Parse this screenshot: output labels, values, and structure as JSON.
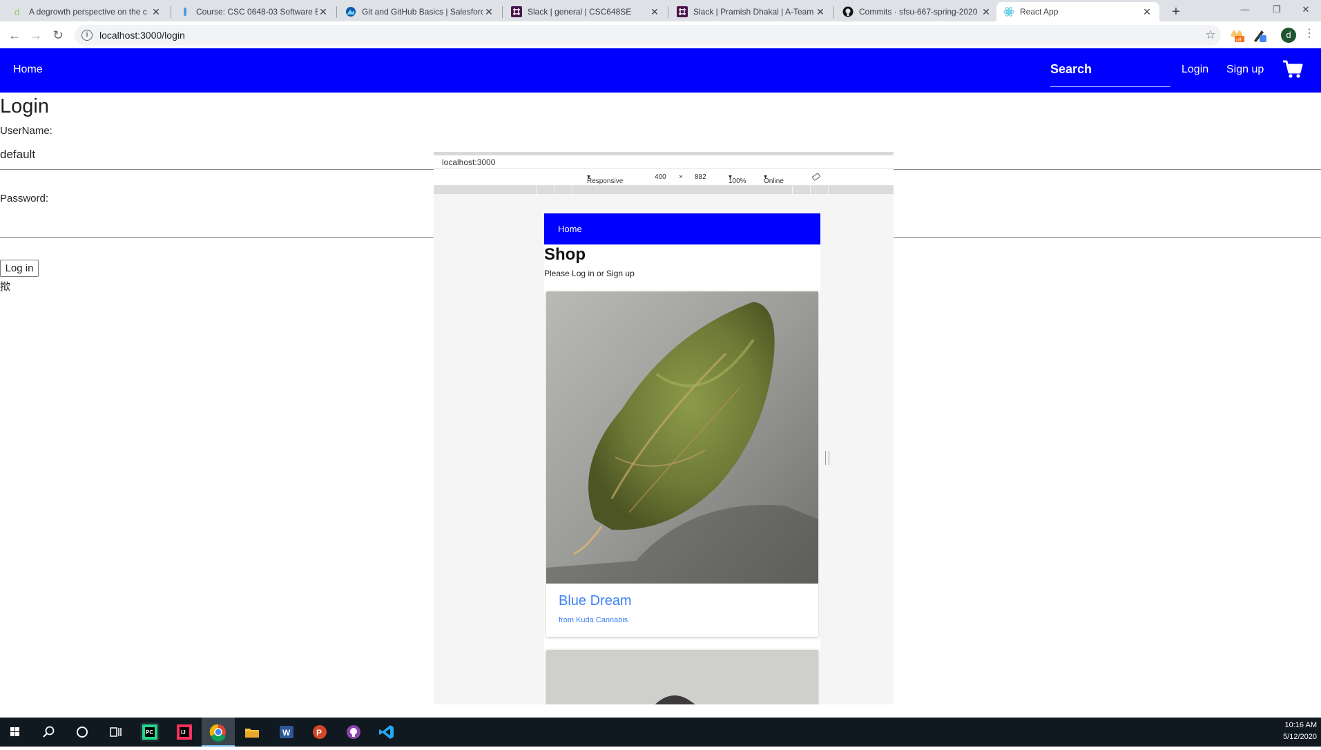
{
  "browser": {
    "tabs": [
      {
        "title": "A degrowth perspective on the c",
        "icon": "d-favicon-icon"
      },
      {
        "title": "Course: CSC 0648-03 Software E",
        "icon": "info-favicon-icon"
      },
      {
        "title": "Git and GitHub Basics | Salesforc",
        "icon": "trailhead-favicon-icon"
      },
      {
        "title": "Slack | general | CSC648SE",
        "icon": "slack-favicon-icon"
      },
      {
        "title": "Slack | Pramish Dhakal | A-Team",
        "icon": "slack-favicon-icon"
      },
      {
        "title": "Commits · sfsu-667-spring-2020",
        "icon": "github-favicon-icon"
      },
      {
        "title": "React App",
        "icon": "react-favicon-icon"
      }
    ],
    "url": "localhost:3000/login",
    "profile_initial": "d",
    "ext_badge": "off"
  },
  "app": {
    "nav": {
      "home": "Home",
      "search_placeholder": "Search",
      "login": "Login",
      "signup": "Sign up"
    },
    "login": {
      "title": "Login",
      "username_label": "UserName:",
      "username_value": "default",
      "password_label": "Password:",
      "button": "Log in",
      "stray_glyph": "揿"
    }
  },
  "emulator": {
    "url": "localhost:3000",
    "device": "Responsive",
    "width": "400",
    "times": "×",
    "height": "882",
    "zoom": "100%",
    "network": "Online",
    "page": {
      "nav_home": "Home",
      "title": "Shop",
      "subtitle": "Please Log in or Sign up",
      "products": [
        {
          "name": "Blue Dream",
          "vendor": "from Kuda Cannabis"
        }
      ]
    }
  },
  "taskbar": {
    "time": "10:16 AM",
    "date": "5/12/2020"
  },
  "colors": {
    "brand_blue": "#0000ff",
    "link_blue": "#3b82f6",
    "taskbar": "#101820"
  }
}
